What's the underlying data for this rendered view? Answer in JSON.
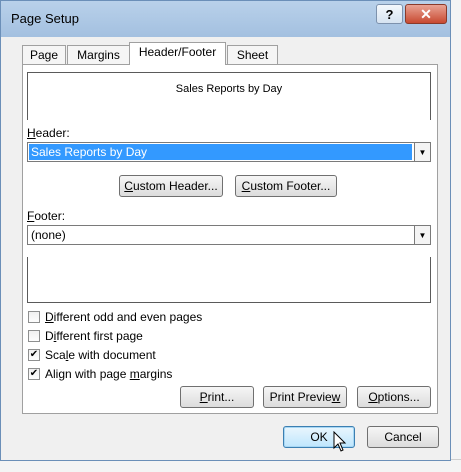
{
  "window": {
    "title": "Page Setup",
    "help_label": "?",
    "close_label": "✕"
  },
  "tabs": [
    {
      "label": "Page",
      "active": false
    },
    {
      "label": "Margins",
      "active": false
    },
    {
      "label": "Header/Footer",
      "active": true
    },
    {
      "label": "Sheet",
      "active": false
    }
  ],
  "header_preview": {
    "text": "Sales Reports by Day"
  },
  "header": {
    "label": "Header:",
    "value": "Sales Reports by Day"
  },
  "custom_header_button": "Custom Header...",
  "custom_footer_button": "Custom Footer...",
  "footer": {
    "label": "Footer:",
    "value": "(none)"
  },
  "options": [
    {
      "label": "Different odd and even pages",
      "checked": false
    },
    {
      "label": "Different first page",
      "checked": false
    },
    {
      "label": "Scale with document",
      "checked": true
    },
    {
      "label": "Align with page margins",
      "checked": true
    }
  ],
  "print_button": "Print...",
  "print_preview_button": "Print Preview",
  "options_button": "Options...",
  "ok_button": "OK",
  "cancel_button": "Cancel",
  "icons": {
    "dropdown": "chevron-down-icon",
    "check": "checkmark-icon",
    "cursor": "mouse-pointer-icon"
  }
}
